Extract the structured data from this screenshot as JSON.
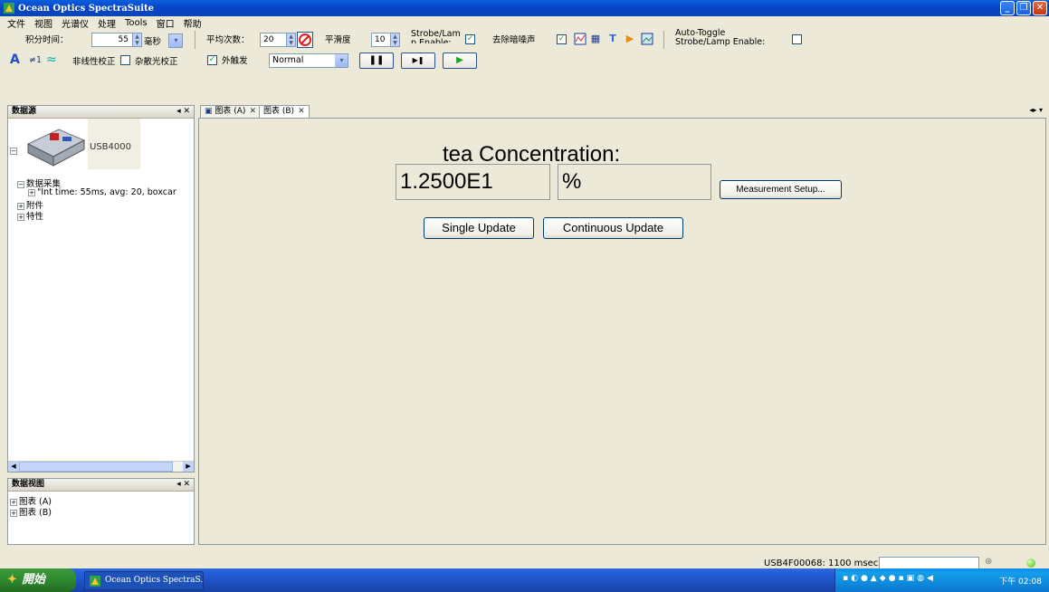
{
  "window": {
    "title": "Ocean Optics SpectraSuite"
  },
  "menu": [
    "文件",
    "视图",
    "光谱仪",
    "处理",
    "Tools",
    "窗口",
    "帮助"
  ],
  "toolbar": {
    "integration_label": "积分时间：",
    "integration_value": "55",
    "integration_unit": "毫秒",
    "avg_label": "平均次数：",
    "avg_value": "20",
    "smooth_label": "平滑度",
    "smooth_value": "10",
    "strobe_label_1": "Strobe/Lam",
    "strobe_label_2": "p Enable:",
    "dark_label": "去除暗噪声",
    "auto_toggle_1": "Auto-Toggle",
    "auto_toggle_2": "Strobe/Lamp Enable:",
    "nonlinear_label": "非线性校正",
    "stray_label": "杂散光校正",
    "external_label": "外触发",
    "mode_value": "Normal"
  },
  "datasource_panel": {
    "title": "数据源",
    "device": "USB4000",
    "tree": [
      "数据采集",
      "\"Int time: 55ms, avg: 20, boxcar",
      "附件",
      "特性"
    ]
  },
  "dataview_panel": {
    "title": "数据视图",
    "items": [
      "图表 (A)",
      "图表 (B)"
    ]
  },
  "tabs": [
    "图表 (A)",
    "图表 (B)"
  ],
  "measurement": {
    "title": "tea Concentration:",
    "value": "1.2500E1",
    "unit": "%",
    "setup_button": "Measurement Setup...",
    "single_update": "Single Update",
    "continuous_update": "Continuous Update"
  },
  "status": {
    "text": "USB4F00068: 1100 msec"
  },
  "taskbar": {
    "start": "開始",
    "app_item": "Ocean Optics SpectraS...",
    "clock": "下午 02:08"
  }
}
